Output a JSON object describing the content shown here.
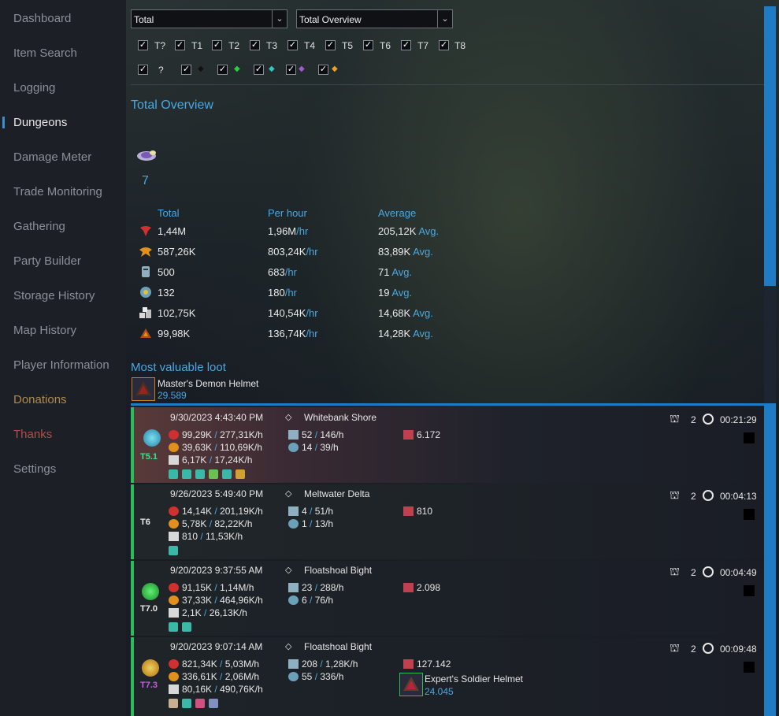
{
  "sidebar": {
    "items": [
      "Dashboard",
      "Item Search",
      "Logging",
      "Dungeons",
      "Damage Meter",
      "Trade Monitoring",
      "Gathering",
      "Party Builder",
      "Storage History",
      "Map History",
      "Player Information",
      "Donations",
      "Thanks",
      "Settings"
    ],
    "active": "Dungeons",
    "colors": {
      "default": "#8a8f99",
      "active": "#e8e8e8",
      "donations": "#b08a4a",
      "thanks": "#b0504a"
    }
  },
  "filters": {
    "select1": "Total",
    "select2": "Total Overview",
    "tiers": [
      "T?",
      "T1",
      "T2",
      "T3",
      "T4",
      "T5",
      "T6",
      "T7",
      "T8"
    ],
    "rarity_label": "?",
    "rarity_gems": [
      "black-gem",
      "green-gem",
      "teal-gem",
      "purple-gem",
      "orange-gem"
    ]
  },
  "overview": {
    "title": "Total Overview",
    "dungeon_count": "7",
    "headers": {
      "total": "Total",
      "per_hour": "Per hour",
      "average": "Average"
    },
    "per_hour_unit": "/hr",
    "avg_unit": "Avg.",
    "rows": [
      {
        "icon": "fame-icon",
        "total": "1,44M",
        "per_hour": "1,96M",
        "average": "205,12K"
      },
      {
        "icon": "reputation-icon",
        "total": "587,26K",
        "per_hour": "803,24K",
        "average": "83,89K"
      },
      {
        "icon": "re-spec-icon",
        "total": "500",
        "per_hour": "683",
        "average": "71"
      },
      {
        "icon": "might-icon",
        "total": "132",
        "per_hour": "180",
        "average": "19"
      },
      {
        "icon": "silver-icon",
        "total": "102,75K",
        "per_hour": "140,54K",
        "average": "14,68K"
      },
      {
        "icon": "faction-icon",
        "total": "99,98K",
        "per_hour": "136,74K",
        "average": "14,28K"
      }
    ]
  },
  "loot": {
    "title": "Most valuable loot",
    "item": "Master's Demon Helmet",
    "value": "29.589"
  },
  "dungeons": [
    {
      "date": "9/30/2023 4:43:40 PM",
      "zone": "Whitebank Shore",
      "tier": "T5.1",
      "tier_color": "#3ee08a",
      "icon_color": "#3ab8d8",
      "fame": "99,29K",
      "fame_h": "277,31K/h",
      "rep": "39,63K",
      "rep_h": "110,69K/h",
      "silver": "6,17K",
      "silver_h": "17,24K/h",
      "respec": "52",
      "respec_h": "146/h",
      "might": "14",
      "might_h": "39/h",
      "loot_value": "6.172",
      "players": "2",
      "time": "00:21:29",
      "loot_item": "",
      "loot_item_value": ""
    },
    {
      "date": "9/26/2023 5:49:40 PM",
      "zone": "Meltwater Delta",
      "tier": "T6",
      "tier_color": "#e8e8e8",
      "icon_color": "#1c1f26",
      "fame": "14,14K",
      "fame_h": "201,19K/h",
      "rep": "5,78K",
      "rep_h": "82,22K/h",
      "silver": "810",
      "silver_h": "11,53K/h",
      "respec": "4",
      "respec_h": "51/h",
      "might": "1",
      "might_h": "13/h",
      "loot_value": "810",
      "players": "2",
      "time": "00:04:13",
      "loot_item": "",
      "loot_item_value": ""
    },
    {
      "date": "9/20/2023 9:37:55 AM",
      "zone": "Floatshoal Bight",
      "tier": "T7.0",
      "tier_color": "#e8e8e8",
      "icon_color": "#2ecc40",
      "fame": "91,15K",
      "fame_h": "1,14M/h",
      "rep": "37,33K",
      "rep_h": "464,96K/h",
      "silver": "2,1K",
      "silver_h": "26,13K/h",
      "respec": "23",
      "respec_h": "288/h",
      "might": "6",
      "might_h": "76/h",
      "loot_value": "2.098",
      "players": "2",
      "time": "00:04:49",
      "loot_item": "",
      "loot_item_value": ""
    },
    {
      "date": "9/20/2023 9:07:14 AM",
      "zone": "Floatshoal Bight",
      "tier": "T7.3",
      "tier_color": "#c95be0",
      "icon_color": "#e0a020",
      "fame": "821,34K",
      "fame_h": "5,03M/h",
      "rep": "336,61K",
      "rep_h": "2,06M/h",
      "silver": "80,16K",
      "silver_h": "490,76K/h",
      "respec": "208",
      "respec_h": "1,28K/h",
      "might": "55",
      "might_h": "336/h",
      "loot_value": "127.142",
      "players": "2",
      "time": "00:09:48",
      "loot_item": "Expert's Soldier Helmet",
      "loot_item_value": "24.045"
    }
  ]
}
